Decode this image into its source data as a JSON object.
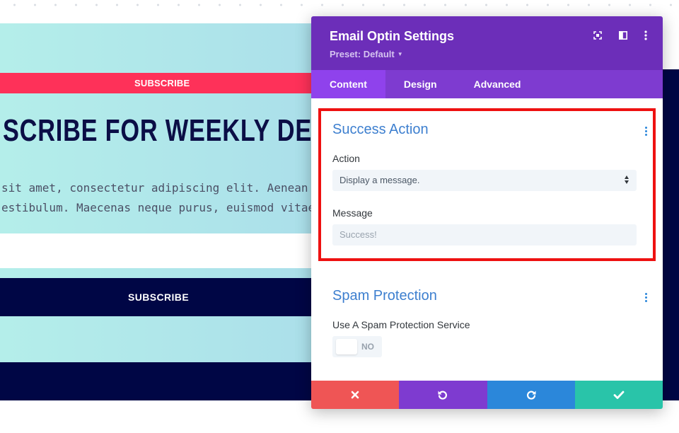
{
  "background_page": {
    "subscribe_banner": "SUBSCRIBE",
    "headline": "SCRIBE FOR WEEKLY DE",
    "body_line_1": " sit amet, consectetur adipiscing elit. Aenean",
    "body_line_2": "estibulum. Maecenas neque purus, euismod vitae",
    "subscribe_button": "SUBSCRIBE"
  },
  "modal": {
    "title": "Email Optin Settings",
    "preset": "Preset: Default",
    "icons": [
      "expand-icon",
      "sidebar-toggle-icon",
      "more-options-icon"
    ],
    "tabs": [
      {
        "label": "Content",
        "active": true
      },
      {
        "label": "Design",
        "active": false
      },
      {
        "label": "Advanced",
        "active": false
      }
    ],
    "success_action": {
      "title": "Success Action",
      "action_label": "Action",
      "action_value": "Display a message.",
      "message_label": "Message",
      "message_placeholder": "Success!"
    },
    "spam_protection": {
      "title": "Spam Protection",
      "service_label": "Use A Spam Protection Service",
      "toggle_value": "NO"
    },
    "footer": [
      "cancel-icon",
      "undo-icon",
      "redo-icon",
      "save-icon"
    ]
  },
  "colors": {
    "header_purple": "#6c2eb9",
    "tab_bar_purple": "#7e3bd0",
    "active_tab": "#8f42ec",
    "section_title_blue": "#3d7fcf",
    "highlight_red": "#ee1111",
    "cancel_red": "#ef5555",
    "redo_blue": "#2b87da",
    "save_teal": "#29c4a9",
    "banner_pink": "#fe3159",
    "navy": "#000645"
  }
}
